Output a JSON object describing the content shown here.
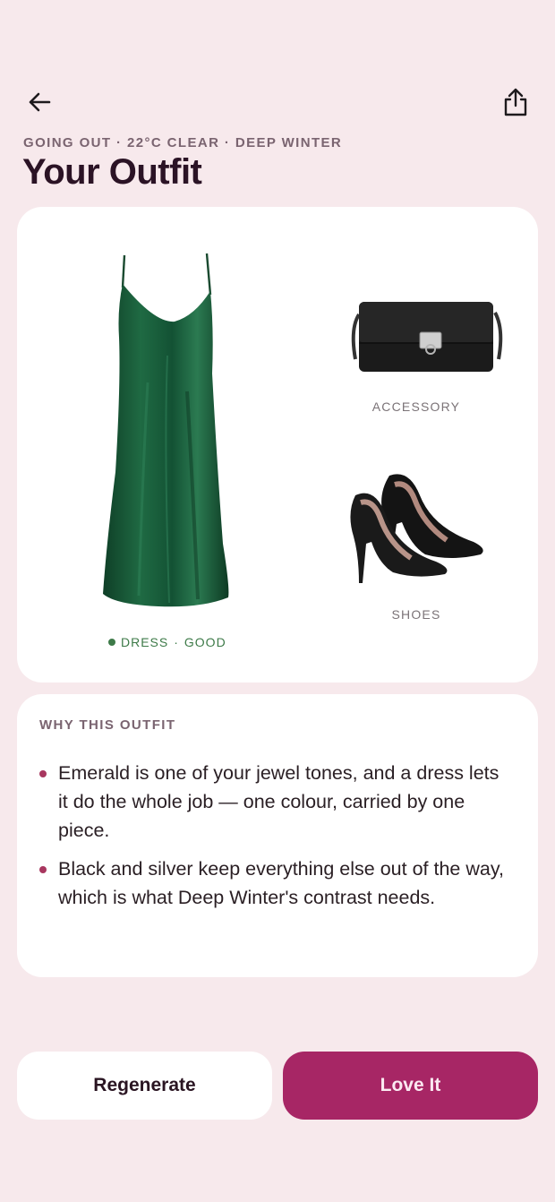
{
  "header": {
    "eyebrow": "GOING OUT · 22°C CLEAR · DEEP WINTER",
    "title": "Your Outfit",
    "back_icon": "arrow-left-icon",
    "share_icon": "share-icon"
  },
  "outfit": {
    "dress": {
      "category": "DRESS",
      "rating": "GOOD",
      "separator": "·",
      "color": "#1f5c3a"
    },
    "accessory": {
      "label": "ACCESSORY"
    },
    "shoes": {
      "label": "SHOES"
    }
  },
  "why": {
    "heading": "WHY THIS OUTFIT",
    "reasons": [
      "Emerald is one of your jewel tones, and a dress lets it do the whole job — one colour, carried by one piece.",
      "Black and silver keep everything else out of the way, which is what Deep Winter's contrast needs."
    ]
  },
  "actions": {
    "regenerate": "Regenerate",
    "love": "Love It"
  },
  "colors": {
    "background": "#f7e9ec",
    "accent": "#a72665",
    "good": "#3d7a48"
  }
}
